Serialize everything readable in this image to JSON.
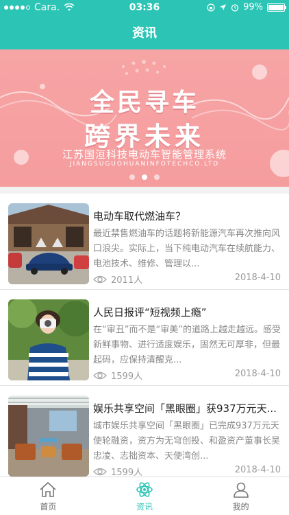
{
  "status_bar": {
    "carrier": "Cara.",
    "time": "03:36",
    "battery_text": "99%",
    "battery_level": 0.99
  },
  "header": {
    "title": "资讯"
  },
  "banner": {
    "title_line1": "全民寻车",
    "title_line2": "跨界未来",
    "subtitle": "江苏国洹科技电动车智能管理系统",
    "subtitle_en": "JIANGSUGUOHUANINFOTECHCO.LTD",
    "page_count": 3,
    "active_page": 2
  },
  "news": [
    {
      "title": "电动车取代燃油车？",
      "desc": "最近禁售燃油车的话题将新能源汽车再次推向风口浪尖。实际上，当下纯电动汽车在续航能力、电池技术、维修、管理以...",
      "views": "2011人",
      "date": "2018-4-10",
      "thumb_icon": "electric-car-photo"
    },
    {
      "title": "人民日报评“短视频上瘾”",
      "desc": "在“审丑”而不是“审美”的道路上越走越远。感受新鲜事物、进行适度娱乐，固然无可厚非，但最起码，应保持清醒克...",
      "views": "1599人",
      "date": "2018-4-10",
      "thumb_icon": "girl-with-camera-photo"
    },
    {
      "title": "娱乐共享空间「黑眼圈」获937万元天...",
      "desc": "城市娱乐共享空间「黑眼圈」已完成937万元天使轮融资，资方为无穹创投、和盈资产董事长吴忠凌、志拙资本、天使湾创...",
      "views": "1599人",
      "date": "2018-4-10",
      "thumb_icon": "outdoor-lounge-photo"
    }
  ],
  "tabs": [
    {
      "label": "首页",
      "icon": "home-icon",
      "active": false
    },
    {
      "label": "资讯",
      "icon": "atom-icon",
      "active": true
    },
    {
      "label": "我的",
      "icon": "user-icon",
      "active": false
    }
  ],
  "colors": {
    "accent": "#2cc4b5",
    "banner_bg": "#f7a4a5"
  }
}
